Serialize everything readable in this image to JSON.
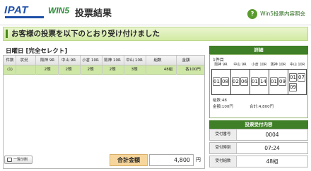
{
  "header": {
    "logo_ipat": "IPAT",
    "logo_win5": "WIN5",
    "title": "投票結果",
    "help_label": "Win5投票内容照会"
  },
  "banner": "お客様の投票を以下のとおり受け付けました",
  "section_title": "日曜日 [完全セレクト]",
  "table": {
    "columns": [
      "件数",
      "状況",
      "阪神 9R",
      "中山 9R",
      "小倉 10R",
      "阪神 10R",
      "中山 10R",
      "組数",
      "金額"
    ],
    "row": [
      "(1)",
      "",
      "2頭",
      "2頭",
      "2頭",
      "2頭",
      "3頭",
      "48組",
      "各100円"
    ]
  },
  "print_button": "一覧印刷",
  "total": {
    "label": "合計金額",
    "value": "4,800",
    "unit": "円"
  },
  "detail": {
    "heading": "詳細",
    "day": "1件目",
    "races": [
      "阪神 9R",
      "中山 9R",
      "小倉 10R",
      "阪神 10R",
      "中山 10R"
    ],
    "selections": [
      [
        "01",
        "08"
      ],
      [
        "02",
        "06"
      ],
      [
        "01",
        "14"
      ],
      [
        "01",
        "09"
      ],
      [
        "01",
        "07",
        "09"
      ]
    ],
    "kumisu": "組数:48",
    "kingaku": "金額:100円",
    "goukei": "合計:4,800円"
  },
  "receipt": {
    "heading": "投票受付内容",
    "rows": [
      {
        "label": "受付番号",
        "value": "0004"
      },
      {
        "label": "受付時刻",
        "value": "07:24"
      },
      {
        "label": "受付組数",
        "value": "48組"
      }
    ]
  },
  "colors": {
    "accent_green": "#3f7f27",
    "selected_row": "#cfe7a6",
    "ipat_blue": "#1e4fa8"
  }
}
